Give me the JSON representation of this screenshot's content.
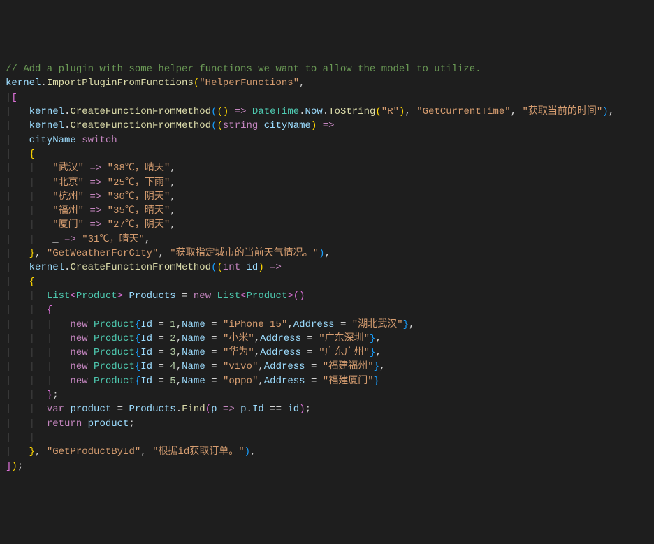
{
  "code": {
    "comment": "// Add a plugin with some helper functions we want to allow the model to utilize.",
    "kernel": "kernel",
    "importMethod": "ImportPluginFromFunctions",
    "helperFunctions": "\"HelperFunctions\"",
    "createMethod": "CreateFunctionFromMethod",
    "dateTime": "DateTime",
    "now": "Now",
    "toString": "ToString",
    "rFormat": "\"R\"",
    "getCurrentTime": "\"GetCurrentTime\"",
    "getCurrentTimeDesc": "\"获取当前的时间\"",
    "stringType": "string",
    "cityName": "cityName",
    "switchKw": "switch",
    "city1": "\"武汉\"",
    "weather1": "\"38℃，晴天\"",
    "city2": "\"北京\"",
    "weather2": "\"25℃，下雨\"",
    "city3": "\"杭州\"",
    "weather3": "\"30℃，阴天\"",
    "city4": "\"福州\"",
    "weather4": "\"35℃，晴天\"",
    "city5": "\"厦门\"",
    "weather5": "\"27℃，阴天\"",
    "defaultWeather": "\"31℃，晴天\"",
    "getWeatherForCity": "\"GetWeatherForCity\"",
    "getWeatherDesc": "\"获取指定城市的当前天气情况。\"",
    "intType": "int",
    "idParam": "id",
    "listType": "List",
    "productType": "Product",
    "productsVar": "Products",
    "newKw": "new",
    "idProp": "Id",
    "nameProp": "Name",
    "addressProp": "Address",
    "id1": "1",
    "name1": "\"iPhone 15\"",
    "addr1": "\"湖北武汉\"",
    "id2": "2",
    "name2": "\"小米\"",
    "addr2": "\"广东深圳\"",
    "id3": "3",
    "name3": "\"华为\"",
    "addr3": "\"广东广州\"",
    "id4": "4",
    "name4": "\"vivo\"",
    "addr4": "\"福建福州\"",
    "id5": "5",
    "name5": "\"oppo\"",
    "addr5": "\"福建厦门\"",
    "varKw": "var",
    "productVar": "product",
    "findMethod": "Find",
    "pParam": "p",
    "returnKw": "return",
    "getProductById": "\"GetProductById\"",
    "getProductDesc": "\"根据id获取订单。\""
  }
}
